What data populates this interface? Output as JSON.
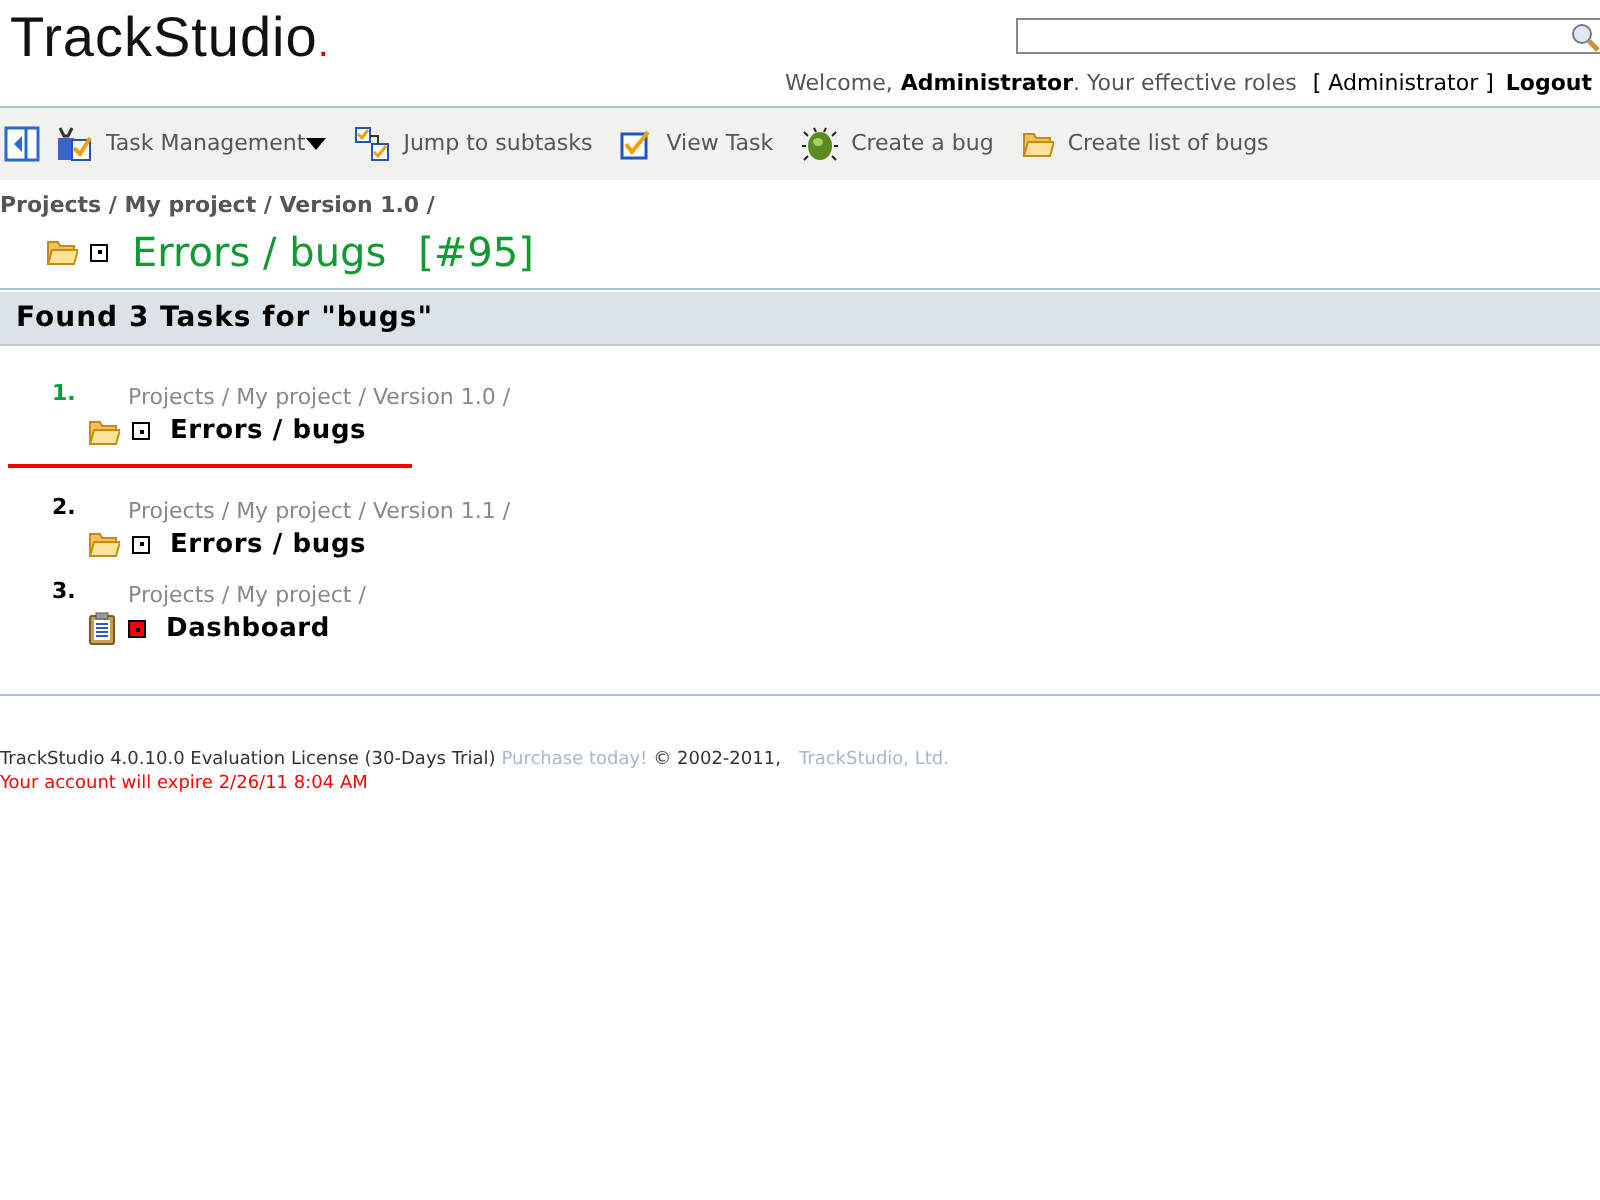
{
  "logo": {
    "text": "TrackStudio",
    "dot": "."
  },
  "user_bar": {
    "welcome": "Welcome,",
    "user": "Administrator",
    "roles_label": ". Your effective roles",
    "roles": "[ Administrator ]",
    "logout": "Logout"
  },
  "toolbar": [
    {
      "kind": "task-management",
      "label": "Task Management",
      "dropdown": true
    },
    {
      "kind": "subtasks",
      "label": "Jump to subtasks",
      "dropdown": false
    },
    {
      "kind": "view",
      "label": "View Task",
      "dropdown": false
    },
    {
      "kind": "bug",
      "label": "Create a bug",
      "dropdown": false
    },
    {
      "kind": "folder",
      "label": "Create list of bugs",
      "dropdown": false
    }
  ],
  "breadcrumb": "Projects / My project / Version 1.0 /",
  "task_title": "Errors / bugs",
  "task_number": "[#95]",
  "results_heading": "Found 3 Tasks for \"bugs\"",
  "results": [
    {
      "number": "1.",
      "path": "Projects / My project / Version 1.0 /",
      "name": "Errors / bugs",
      "kind": "folder",
      "color": "#ffffff",
      "selected": true
    },
    {
      "number": "2.",
      "path": "Projects / My project / Version 1.1 /",
      "name": "Errors / bugs",
      "kind": "folder",
      "color": "#ffffff",
      "selected": false
    },
    {
      "number": "3.",
      "path": "Projects / My project /",
      "name": "Dashboard",
      "kind": "document",
      "color": "#ff0000",
      "selected": false
    }
  ],
  "footer": {
    "license": "TrackStudio 4.0.10.0 Evaluation License (30-Days Trial)",
    "purchase": "Purchase today!",
    "copyright": "© 2002-2011,",
    "company": "TrackStudio, Ltd.",
    "expiry": "Your account will expire 2/26/11 8:04 AM"
  }
}
